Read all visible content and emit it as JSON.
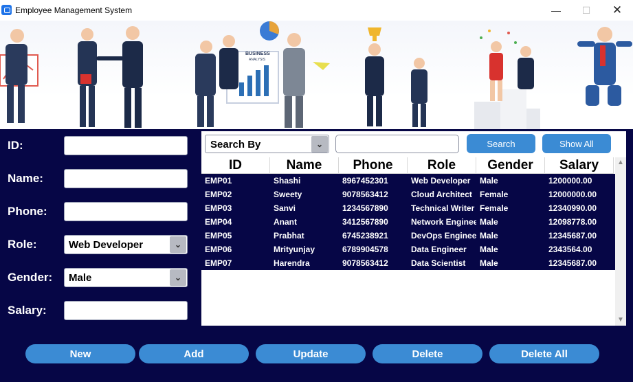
{
  "window": {
    "title": "Employee Management System",
    "minimize": "—",
    "maximize": "☐",
    "close": "✕"
  },
  "banner": {
    "sign_text_1": "BUSINESS",
    "sign_text_2": "ANALYSIS"
  },
  "form": {
    "id_label": "ID:",
    "name_label": "Name:",
    "phone_label": "Phone:",
    "role_label": "Role:",
    "gender_label": "Gender:",
    "salary_label": "Salary:",
    "id_value": "",
    "name_value": "",
    "phone_value": "",
    "role_value": "Web Developer",
    "gender_value": "Male",
    "salary_value": ""
  },
  "search": {
    "search_by_label": "Search By",
    "search_value": "",
    "search_button": "Search",
    "show_all_button": "Show All"
  },
  "table": {
    "columns": [
      "ID",
      "Name",
      "Phone",
      "Role",
      "Gender",
      "Salary"
    ],
    "rows": [
      [
        "EMP01",
        "Shashi",
        "8967452301",
        "Web Developer",
        "Male",
        "1200000.00"
      ],
      [
        "EMP02",
        "Sweety",
        "9078563412",
        "Cloud Architect",
        "Female",
        "12000000.00"
      ],
      [
        "EMP03",
        "Sanvi",
        "1234567890",
        "Technical Writer",
        "Female",
        "12340990.00"
      ],
      [
        "EMP04",
        "Anant",
        "3412567890",
        "Network Engineer",
        "Male",
        "12098778.00"
      ],
      [
        "EMP05",
        "Prabhat",
        "6745238921",
        "DevOps Engineer",
        "Male",
        "12345687.00"
      ],
      [
        "EMP06",
        "Mrityunjay",
        "6789904578",
        "Data Engineer",
        "Male",
        "2343564.00"
      ],
      [
        "EMP07",
        "Harendra",
        "9078563412",
        "Data Scientist",
        "Male",
        "12345687.00"
      ]
    ]
  },
  "actions": {
    "new": "New",
    "add": "Add",
    "update": "Update",
    "delete": "Delete",
    "delete_all": "Delete All"
  },
  "icons": {
    "dropdown": "chevron-down-icon",
    "scroll_up": "scroll-up-icon",
    "scroll_down": "scroll-down-icon"
  },
  "colors": {
    "background": "#060646",
    "button": "#3b8bd4",
    "text": "#ffffff"
  }
}
